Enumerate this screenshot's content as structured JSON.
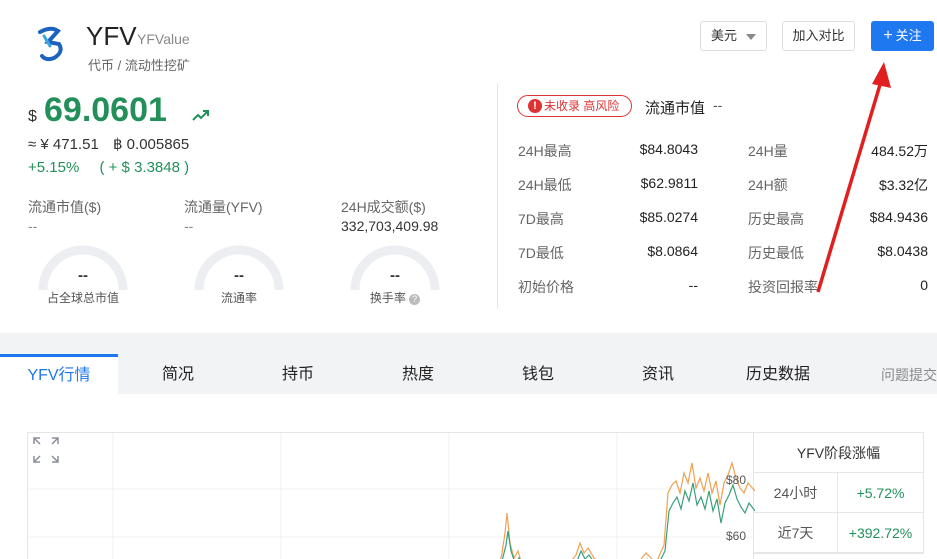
{
  "coin": {
    "symbol": "YFV",
    "full_name": "YFValue",
    "tags": "代币 / 流动性挖矿"
  },
  "toolbar": {
    "currency": "美元",
    "compare_label": "加入对比",
    "follow_label": "关注"
  },
  "price": {
    "currency_symbol": "$",
    "value": "69.0601",
    "cny": "≈ ¥ 471.51",
    "btc": "฿ 0.005865",
    "change_pct": "+5.15%",
    "change_abs": "( + $ 3.3848 )"
  },
  "stats": {
    "market_cap_label": "流通市值($)",
    "market_cap_value": "--",
    "circ_supply_label": "流通量(YFV)",
    "circ_supply_value": "--",
    "volume_label": "24H成交额($)",
    "volume_value": "332,703,409.98"
  },
  "gauges": [
    {
      "value": "--",
      "label": "占全球总市值"
    },
    {
      "value": "--",
      "label": "流通率"
    },
    {
      "value": "--",
      "label": "换手率"
    }
  ],
  "risk": {
    "badge": "未收录 高风险",
    "circ_title": "流通市值",
    "circ_value": "--"
  },
  "kv_left": [
    {
      "label": "24H最高",
      "value": "$84.8043"
    },
    {
      "label": "24H最低",
      "value": "$62.9811"
    },
    {
      "label": "7D最高",
      "value": "$85.0274"
    },
    {
      "label": "7D最低",
      "value": "$8.0864"
    },
    {
      "label": "初始价格",
      "value": "--"
    }
  ],
  "kv_right": [
    {
      "label": "24H量",
      "value": "484.52万"
    },
    {
      "label": "24H额",
      "value": "$3.32亿"
    },
    {
      "label": "历史最高",
      "value": "$84.9436"
    },
    {
      "label": "历史最低",
      "value": "$8.0438"
    },
    {
      "label": "投资回报率",
      "value": "0"
    }
  ],
  "tabs": [
    "YFV行情",
    "简况",
    "持币",
    "热度",
    "钱包",
    "资讯",
    "历史数据"
  ],
  "feedback": "问题提交",
  "chart": {
    "y_tick_high": "$80",
    "y_tick_low": "$60",
    "colors": {
      "price": "#f0a050",
      "secondary": "#3aa07a"
    }
  },
  "period": {
    "title": "YFV阶段涨幅",
    "rows": [
      {
        "label": "24小时",
        "value": "+5.72%"
      },
      {
        "label": "近7天",
        "value": "+392.72%"
      }
    ]
  }
}
